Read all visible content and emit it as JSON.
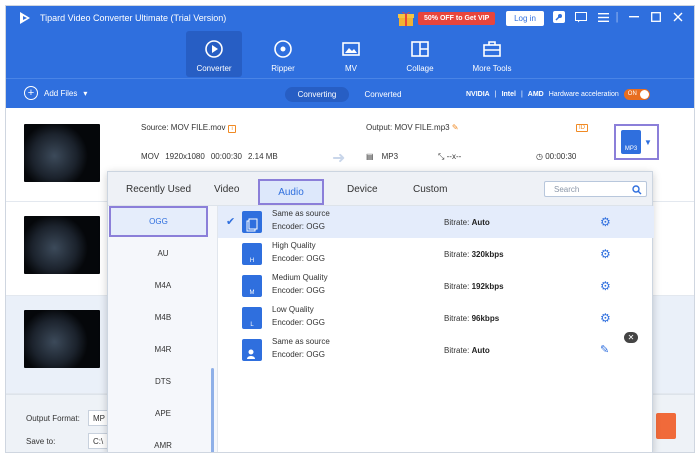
{
  "app": {
    "title": "Tipard Video Converter Ultimate (Trial Version)",
    "promo": "50% OFF to Get VIP",
    "login": "Log in"
  },
  "nav": {
    "tabs": [
      "Converter",
      "Ripper",
      "MV",
      "Collage",
      "More Tools"
    ],
    "active": "Converter"
  },
  "toolbar": {
    "add_files": "Add Files",
    "converting": "Converting",
    "converted": "Converted",
    "nvidia": "NVIDIA",
    "intel": "Intel",
    "amd": "AMD",
    "hw_label": "Hardware acceleration",
    "toggle": "ON"
  },
  "file": {
    "source": "Source: MOV FILE.mov",
    "output": "Output: MOV FILE.mp3",
    "src_format": "MOV",
    "src_res": "1920x1080",
    "src_dur": "00:00:30",
    "src_size": "2.14 MB",
    "out_format": "MP3",
    "out_res": "--x--",
    "out_dur": "00:00:30",
    "format_icon": "MP3"
  },
  "panel": {
    "tabs": [
      "Recently Used",
      "Video",
      "Audio",
      "Device",
      "Custom"
    ],
    "active_tab": "Audio",
    "search_placeholder": "Search",
    "formats": [
      "OGG",
      "AU",
      "M4A",
      "M4B",
      "M4R",
      "DTS",
      "APE",
      "AMR"
    ],
    "active_format": "OGG",
    "presets": [
      {
        "name": "Same as source",
        "encoder": "Encoder: OGG",
        "bitrate_label": "Bitrate:",
        "bitrate": "Auto",
        "icon": "copy-icon",
        "selected": true,
        "action": "gear"
      },
      {
        "name": "High Quality",
        "encoder": "Encoder: OGG",
        "bitrate_label": "Bitrate:",
        "bitrate": "320kbps",
        "icon": "H",
        "selected": false,
        "action": "gear"
      },
      {
        "name": "Medium Quality",
        "encoder": "Encoder: OGG",
        "bitrate_label": "Bitrate:",
        "bitrate": "192kbps",
        "icon": "M",
        "selected": false,
        "action": "gear"
      },
      {
        "name": "Low Quality",
        "encoder": "Encoder: OGG",
        "bitrate_label": "Bitrate:",
        "bitrate": "96kbps",
        "icon": "L",
        "selected": false,
        "action": "gear"
      },
      {
        "name": "Same as source",
        "encoder": "Encoder: OGG",
        "bitrate_label": "Bitrate:",
        "bitrate": "Auto",
        "icon": "user-edit-icon",
        "selected": false,
        "action": "edit"
      }
    ]
  },
  "bottom": {
    "output_format_label": "Output Format:",
    "output_format_value": "MP",
    "save_to_label": "Save to:",
    "save_to_value": "C:\\"
  },
  "colors": {
    "brand": "#2f6fde",
    "accent": "#f06a3a",
    "highlight": "#8b7fd9"
  }
}
